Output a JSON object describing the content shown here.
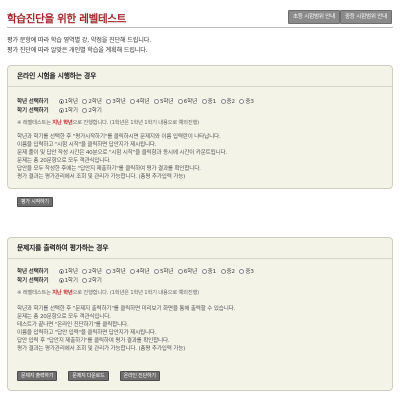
{
  "header": {
    "title": "학습진단을 위한 레벨테스트",
    "buttons": [
      "초등 시험범위 안내",
      "중등 시험범위 안내"
    ],
    "intro": [
      "평가 문항에 따라 학습 영역별 강, 약점을 진단해 드립니다.",
      "평가 진단에 따라 알맞은 개인별 학습을 계획해 드립니다."
    ]
  },
  "grades": [
    "1학년",
    "2학년",
    "3학년",
    "4학년",
    "5학년",
    "6학년",
    "중1",
    "중2",
    "중3"
  ],
  "terms": [
    "1학기",
    "2학기"
  ],
  "online": {
    "title": "온라인 시험을 시행하는 경우",
    "grade_label": "학년 선택하기",
    "term_label": "학기 선택하기",
    "note_prefix": "※ 레벨테스트는 ",
    "note_warn": "지난 학년",
    "note_suffix": "으로 진행합니다. (1학년은 1학년 1학기 내용으로 예외진행)",
    "lines": [
      "학년과 학기를 선택한 후 \"평가시작하기\"를 클릭하시면 문제지와 이름 입력란이 나타납니다.",
      "이름을 입력하고 \"시험 시작\"을 클릭하면 답안지가 제시됩니다.",
      "문제 풀이 및 답안 작성 시간은 40분으로 \"시험 시작\"을 클릭함과 동시에 시간이 카운트됩니다.",
      "문제는 총 20문항으로 모두 객관식입니다.",
      "답안을 모두 작성한 후에는 \"답안지 제출하기\"를 클릭하여 평가 결과를 확인합니다.",
      "평가 결과는 평가관리에서 조회 및 관리가 가능합니다. (총평 추가입력 가능)"
    ],
    "button": "평가 시작하기"
  },
  "print": {
    "title": "문제지를 출력하여 평가하는 경우",
    "grade_label": "학년 선택하기",
    "term_label": "학기 선택하기",
    "note_prefix": "※ 레벨테스트는 ",
    "note_warn": "지난 학년",
    "note_suffix": "으로 진행합니다. (1학년은 1학년 1학기 내용으로 예외진행)",
    "lines": [
      "학년과 학기를 선택한 후 \"문제지 출력하기\"를 클릭하면 미리보기 화면을 통해 출력할 수 있습니다.",
      "문제는 총 20문항으로 모두 객관식입니다.",
      "테스트가 끝나면 \"온라인 진단하기\"를 클릭합니다.",
      "이름을 입력하고 \"답안 입력\"을 클릭하면 답안지가 제시됩니다.",
      "답안 입력 후 \"답안지 제출하기\"를 클릭하여 평가 결과를 확인합니다.",
      "평가 결과는 평가관리에서 조회 및 관리가 가능합니다. (총평 추가입력 가능)"
    ],
    "buttons": [
      "문제지 출력하기",
      "문제지 다운로드",
      "온라인 진단하기"
    ]
  }
}
